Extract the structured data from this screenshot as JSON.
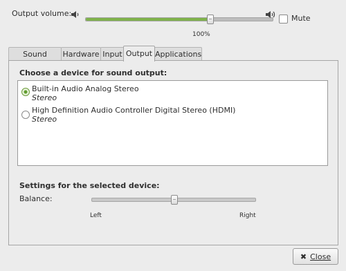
{
  "output_volume": {
    "label": "Output volume:",
    "level_percent": 100,
    "level_fraction": 0.66,
    "value_text": "100%",
    "mute_label": "Mute",
    "mute_checked": false
  },
  "tabs": [
    {
      "label": "Sound Effects"
    },
    {
      "label": "Hardware"
    },
    {
      "label": "Input"
    },
    {
      "label": "Output",
      "active": true
    },
    {
      "label": "Applications"
    }
  ],
  "output": {
    "heading": "Choose a device for sound output:",
    "devices": [
      {
        "name": "Built-in Audio Analog Stereo",
        "profile": "Stereo",
        "selected": true
      },
      {
        "name": "High Definition Audio Controller Digital Stereo (HDMI)",
        "profile": "Stereo",
        "selected": false
      }
    ],
    "settings_heading": "Settings for the selected device:",
    "balance_label": "Balance:",
    "balance_fraction": 0.5,
    "balance_left": "Left",
    "balance_right": "Right"
  },
  "footer": {
    "close_label": "Close"
  },
  "colors": {
    "slider_fill": "#7fb24b",
    "radio_selected": "#5f9c2e"
  },
  "icons": {
    "volume_low": "speaker-low-icon",
    "volume_high": "speaker-high-icon",
    "close": "close-icon"
  }
}
